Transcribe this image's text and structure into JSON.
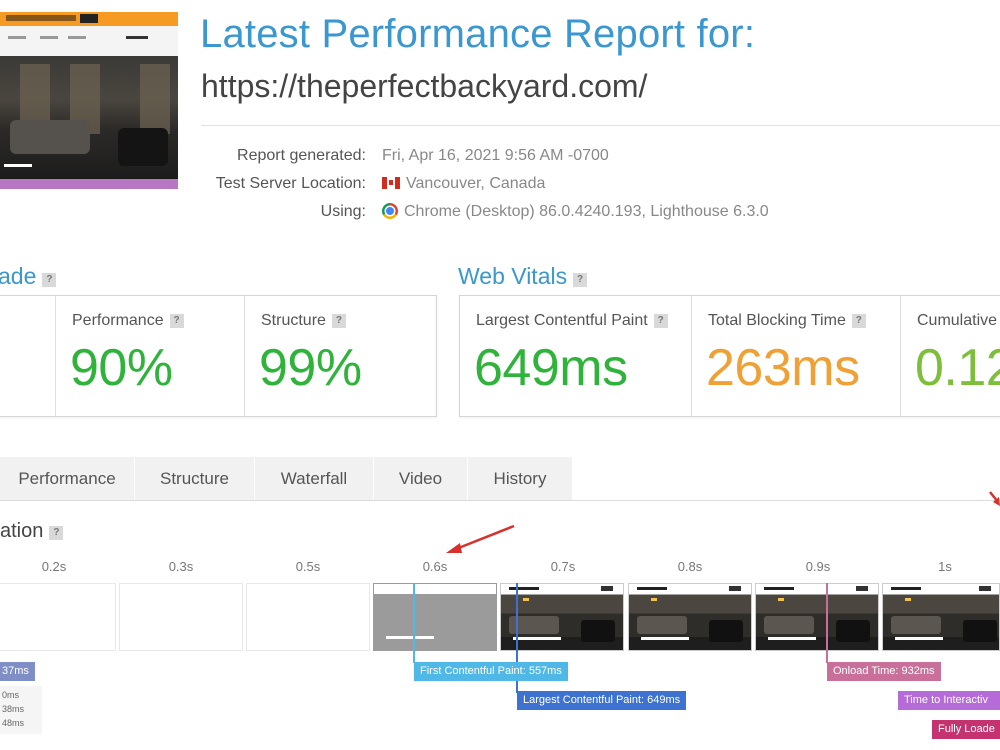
{
  "header": {
    "title": "Latest Performance Report for:",
    "url": "https://theperfectbackyard.com/",
    "meta": [
      {
        "label": "Report generated:",
        "value": "Fri, Apr 16, 2021 9:56 AM -0700"
      },
      {
        "label": "Test Server Location:",
        "value": "Vancouver, Canada",
        "icon": "canada-flag-icon"
      },
      {
        "label": "Using:",
        "value": "Chrome (Desktop) 86.0.4240.193, Lighthouse 6.3.0",
        "icon": "chrome-icon"
      }
    ]
  },
  "grade": {
    "title": "ade",
    "help": "?",
    "metrics": [
      {
        "label": "Performance",
        "value": "90%",
        "color": "#2fb33a"
      },
      {
        "label": "Structure",
        "value": "99%",
        "color": "#2fb33a"
      }
    ]
  },
  "web_vitals": {
    "title": "Web Vitals",
    "help": "?",
    "metrics": [
      {
        "label": "Largest Contentful Paint",
        "value": "649ms",
        "color": "#2fb33a"
      },
      {
        "label": "Total Blocking Time",
        "value": "263ms",
        "color": "#f0a135"
      },
      {
        "label": "Cumulative",
        "value": "0.12",
        "color": "#7dbf3b"
      }
    ]
  },
  "tabs": [
    "Performance",
    "Structure",
    "Waterfall",
    "Video",
    "History"
  ],
  "summary": {
    "title": "ation",
    "help": "?",
    "ticks": [
      "0.2s",
      "0.3s",
      "0.5s",
      "0.6s",
      "0.7s",
      "0.8s",
      "0.9s",
      "1s"
    ],
    "markers": {
      "ttfb": "37ms",
      "fcp": "First Contentful Paint: 557ms",
      "lcp": "Largest Contentful Paint: 649ms",
      "onload": "Onload Time: 932ms",
      "tti": "Time to Interactiv",
      "fully": "Fully Loade"
    },
    "small_timings": [
      "0ms",
      "38ms",
      "48ms"
    ]
  },
  "colors": {
    "accent": "#3a97cf",
    "good": "#2fb33a",
    "warn": "#f0a135",
    "fcp": "#4fb8e6",
    "lcp": "#3d72d1",
    "onload": "#c9709a",
    "tti": "#b56bd8",
    "fully": "#c4336f",
    "arrow": "#d9302c"
  }
}
